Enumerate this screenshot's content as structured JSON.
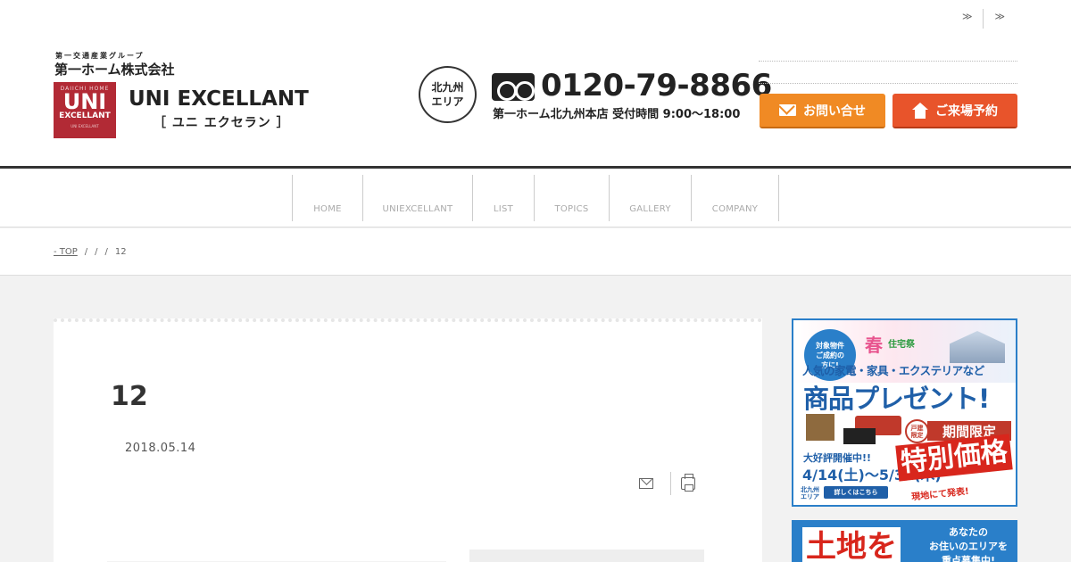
{
  "header": {
    "top_links": [
      "≫",
      "≫"
    ],
    "logo": {
      "group": "第一交通産業グループ",
      "corp": "第一ホーム株式会社",
      "mark_small": "DAIICHI HOME",
      "mark_big": "UNI",
      "mark_mid": "EXCELLANT",
      "mark_tiny": "UNI EXCELLANT",
      "brand": "UNI EXCELLANT",
      "kana": "［ ユニ エクセラン ］"
    },
    "area_badge": [
      "北九州",
      "エリア"
    ],
    "phone": {
      "icon": "free-dial-icon",
      "number": "0120-79-8866",
      "hours": "第一ホーム北九州本店 受付時間 9:00〜18:00"
    },
    "cta": {
      "contact_label": "お問い合せ",
      "contact_icon": "mail-icon",
      "visit_label": "ご来場予約",
      "visit_icon": "house-icon"
    },
    "colors": {
      "brand_red": "#b22a35",
      "contact_orange": "#f08a24",
      "visit_orange": "#e8542b"
    }
  },
  "nav": {
    "items": [
      "HOME",
      "UNIEXCELLANT",
      "LIST",
      "TOPICS",
      "GALLERY",
      "COMPANY"
    ]
  },
  "breadcrumb": {
    "items": [
      "- TOP",
      "/",
      "/",
      "/",
      "12"
    ]
  },
  "article": {
    "title": "12",
    "date": "2018.05.14",
    "share_icons": [
      "mail-icon",
      "print-icon"
    ]
  },
  "sidebar": {
    "banner1": {
      "circle": [
        "対象物件",
        "ご成約の",
        "方に!"
      ],
      "spring": "春",
      "camp": "住宅祭",
      "subtitle": "人気の家電・家具・エクステリアなど",
      "main": "商品プレゼント!",
      "badge": [
        "戸建",
        "限定"
      ],
      "period": "期間限定",
      "open": "大好評開催中!!",
      "dates": "4/14(土)〜5/31(木)",
      "special": "特別価格",
      "area": [
        "北九州",
        "エリア"
      ],
      "more": "詳しくはこちら",
      "reveal": "現地にて発表!"
    },
    "banner2": {
      "land": "土地を",
      "text": [
        "あなたの",
        "お住いのエリアを",
        "重点募集中!"
      ]
    }
  }
}
